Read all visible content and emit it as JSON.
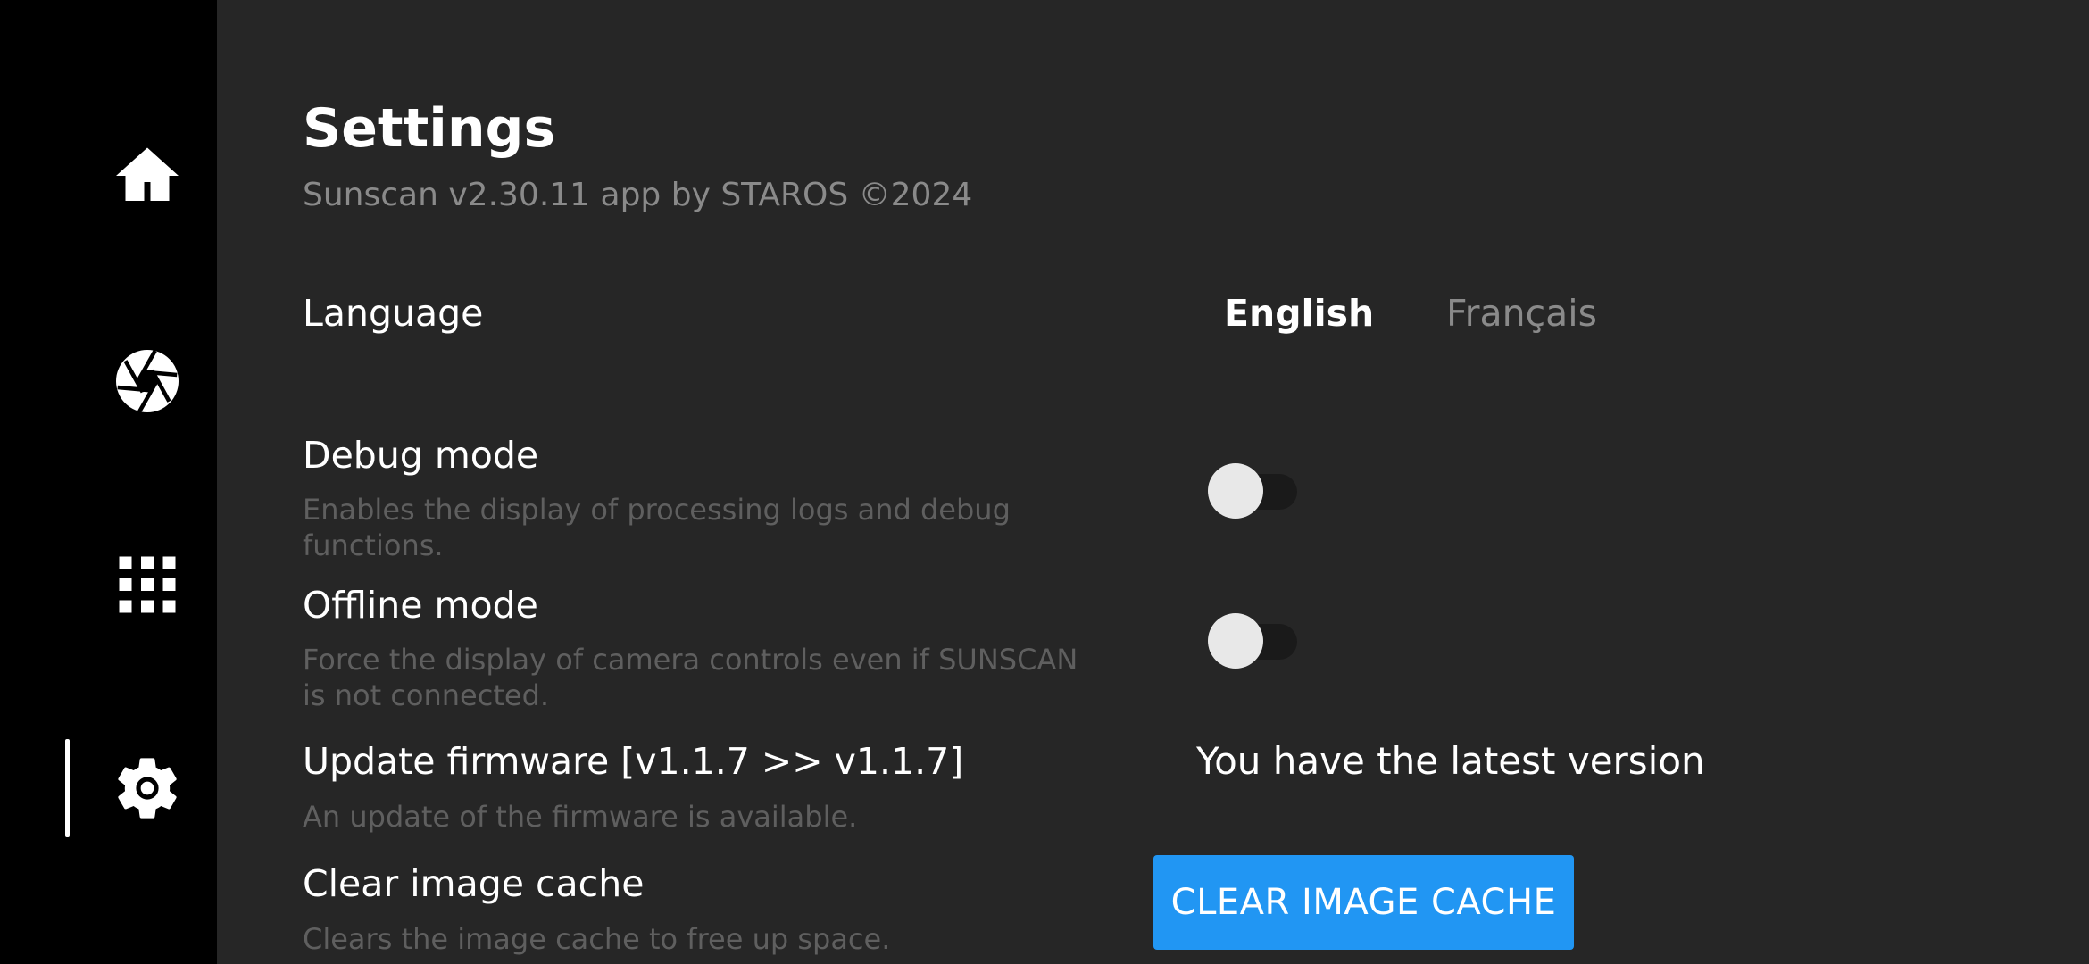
{
  "sidebar": {
    "items": [
      {
        "id": "home",
        "icon": "home-icon",
        "active": false
      },
      {
        "id": "camera",
        "icon": "camera-aperture-icon",
        "active": false
      },
      {
        "id": "gallery",
        "icon": "grid-icon",
        "active": false
      },
      {
        "id": "settings",
        "icon": "gear-icon",
        "active": true
      }
    ]
  },
  "header": {
    "title": "Settings",
    "subtitle": "Sunscan v2.30.11 app by STAROS ©2024"
  },
  "settings": {
    "language": {
      "label": "Language",
      "options": [
        "English",
        "Français"
      ],
      "selected": "English"
    },
    "debug_mode": {
      "label": "Debug mode",
      "description": "Enables the display of processing logs and debug functions.",
      "enabled": false
    },
    "offline_mode": {
      "label": "Offline mode",
      "description": "Force the display of camera controls even if SUNSCAN is not connected.",
      "enabled": false
    },
    "firmware": {
      "label": "Update firmware [v1.1.7 >> v1.1.7]",
      "description": "An update of the firmware is available.",
      "status": "You have the latest version"
    },
    "cache": {
      "label": "Clear image cache",
      "description": "Clears the image cache to free up space.",
      "button_label": "CLEAR IMAGE CACHE"
    }
  },
  "colors": {
    "background": "#262626",
    "sidebar": "#000000",
    "accent": "#2196f3",
    "muted_text": "#8a8a8a",
    "description_text": "#5f5f5f"
  }
}
